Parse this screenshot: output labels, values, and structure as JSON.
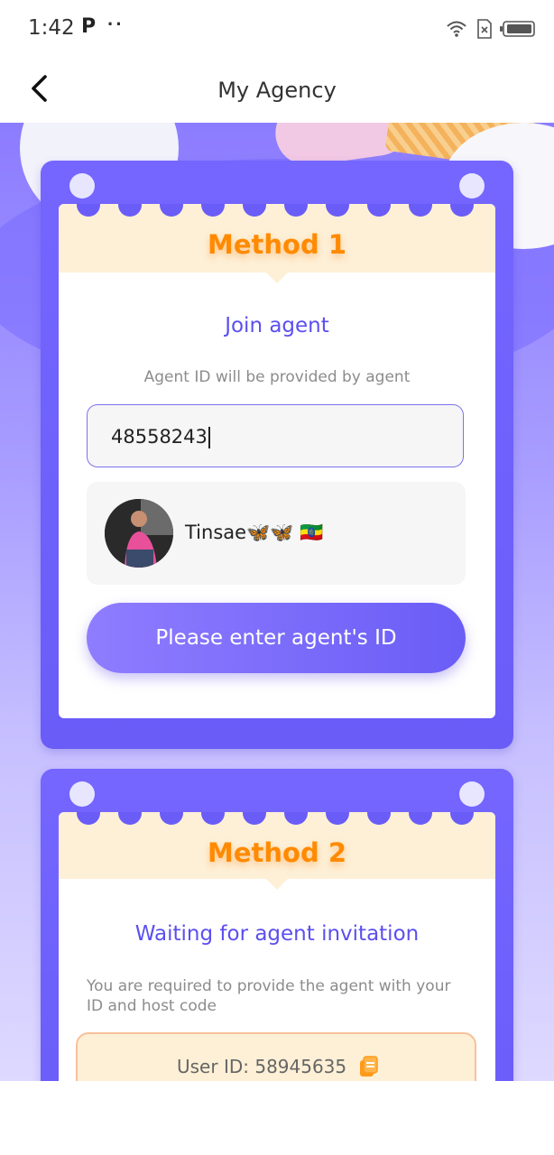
{
  "status_bar": {
    "time": "1:42",
    "p_icon": "P",
    "dots": "··",
    "right_icons": [
      "wifi-icon",
      "sim-x-icon",
      "battery-icon"
    ]
  },
  "app_bar": {
    "back_icon": "chevron-left-icon",
    "title": "My Agency"
  },
  "method1": {
    "header": "Method 1",
    "title": "Join agent",
    "hint": "Agent ID will be provided by agent",
    "input_value": "48558243",
    "agent": {
      "name": "Tinsae🦋🦋 🇪🇹"
    },
    "button_label": "Please enter agent's ID"
  },
  "method2": {
    "header": "Method 2",
    "title": "Waiting for agent invitation",
    "description": "You are required to provide the agent with your ID and host code",
    "user_id": "User ID: 58945635",
    "copy_icon": "copy-icon"
  },
  "colors": {
    "accent_purple": "#6a5cf7",
    "title_orange": "#ff8a00",
    "section_title": "#5b4ff0",
    "header_bg": "#fdf0d6"
  }
}
